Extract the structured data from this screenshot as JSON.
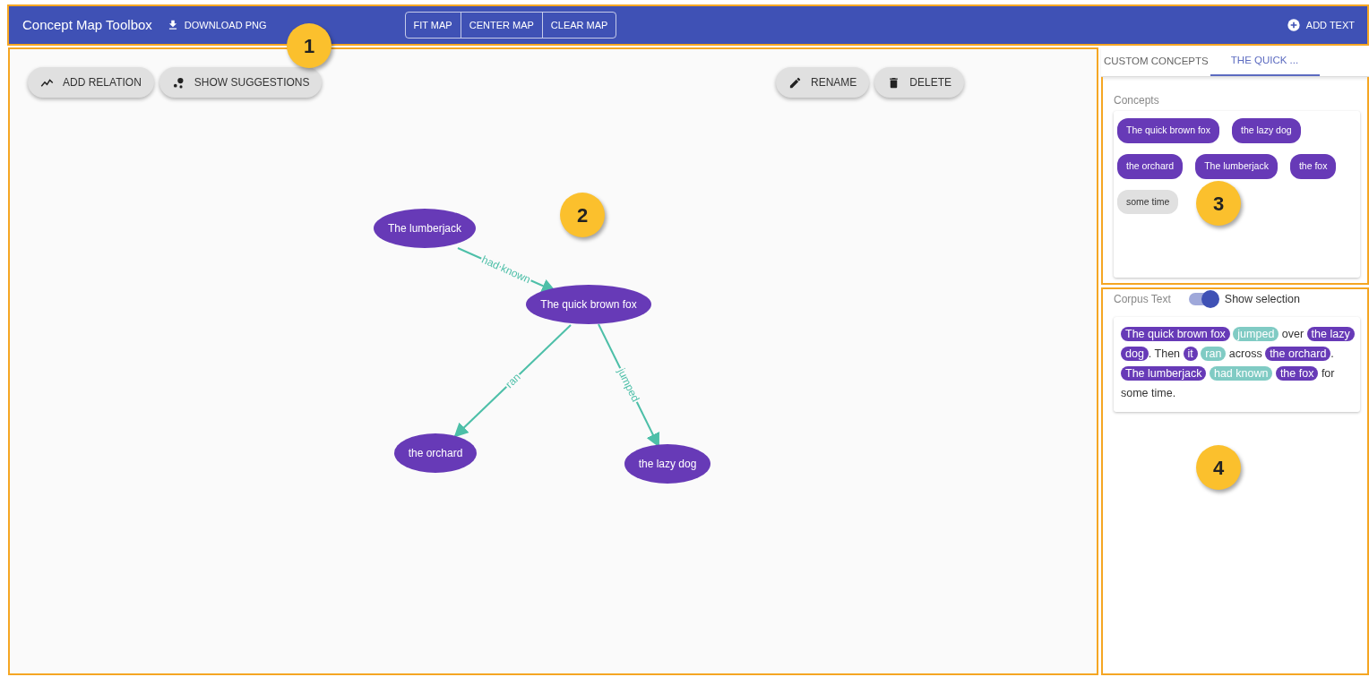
{
  "toolbar": {
    "title": "Concept Map Toolbox",
    "download": "DOWNLOAD PNG",
    "map_buttons": [
      {
        "label": "FIT MAP"
      },
      {
        "label": "CENTER MAP"
      },
      {
        "label": "CLEAR MAP"
      }
    ],
    "add_text": "ADD TEXT"
  },
  "canvas": {
    "left_actions": [
      {
        "kind": "relation",
        "label": "ADD RELATION"
      },
      {
        "kind": "suggest",
        "label": "SHOW SUGGESTIONS"
      }
    ],
    "right_actions": [
      {
        "kind": "rename",
        "label": "RENAME"
      },
      {
        "kind": "delete",
        "label": "DELETE"
      }
    ],
    "nodes": [
      {
        "label": "The lumberjack"
      },
      {
        "label": "The quick brown fox"
      },
      {
        "label": "the orchard"
      },
      {
        "label": "the lazy dog"
      }
    ],
    "relations": [
      {
        "label": "had known"
      },
      {
        "label": "ran"
      },
      {
        "label": "jumped"
      }
    ]
  },
  "tabs": [
    {
      "label": "CUSTOM CONCEPTS",
      "selected": false
    },
    {
      "label": "THE QUICK ...",
      "selected": true
    }
  ],
  "concepts": {
    "title": "Concepts",
    "items": [
      {
        "label": "The quick brown fox",
        "in_map": true
      },
      {
        "label": "the lazy dog",
        "in_map": true
      },
      {
        "label": "the orchard",
        "in_map": true
      },
      {
        "label": "The lumberjack",
        "in_map": true
      },
      {
        "label": "the fox",
        "in_map": true
      },
      {
        "label": "some time",
        "in_map": false
      }
    ]
  },
  "corpus": {
    "title": "Corpus Text",
    "toggle": {
      "label": "Show selection",
      "on": true
    },
    "parts": [
      {
        "kind": "concept",
        "text": "The quick brown fox",
        "space_after": true
      },
      {
        "kind": "relation",
        "text": "jumped"
      },
      {
        "kind": "plain",
        "text": " over "
      },
      {
        "kind": "concept",
        "text": "the lazy dog"
      },
      {
        "kind": "plain",
        "text": ". Then "
      },
      {
        "kind": "concept",
        "text": "it",
        "space_after": true
      },
      {
        "kind": "relation",
        "text": "ran"
      },
      {
        "kind": "plain",
        "text": " across "
      },
      {
        "kind": "concept",
        "text": "the orchard"
      },
      {
        "kind": "plain",
        "text": ". "
      },
      {
        "kind": "concept",
        "text": "The lumberjack",
        "space_after": true
      },
      {
        "kind": "relation",
        "text": "had known",
        "space_after": true
      },
      {
        "kind": "concept",
        "text": "the fox"
      },
      {
        "kind": "plain",
        "text": " for some time."
      }
    ]
  },
  "callouts": [
    {
      "label": "1"
    },
    {
      "label": "2"
    },
    {
      "label": "3"
    },
    {
      "label": "4"
    }
  ]
}
